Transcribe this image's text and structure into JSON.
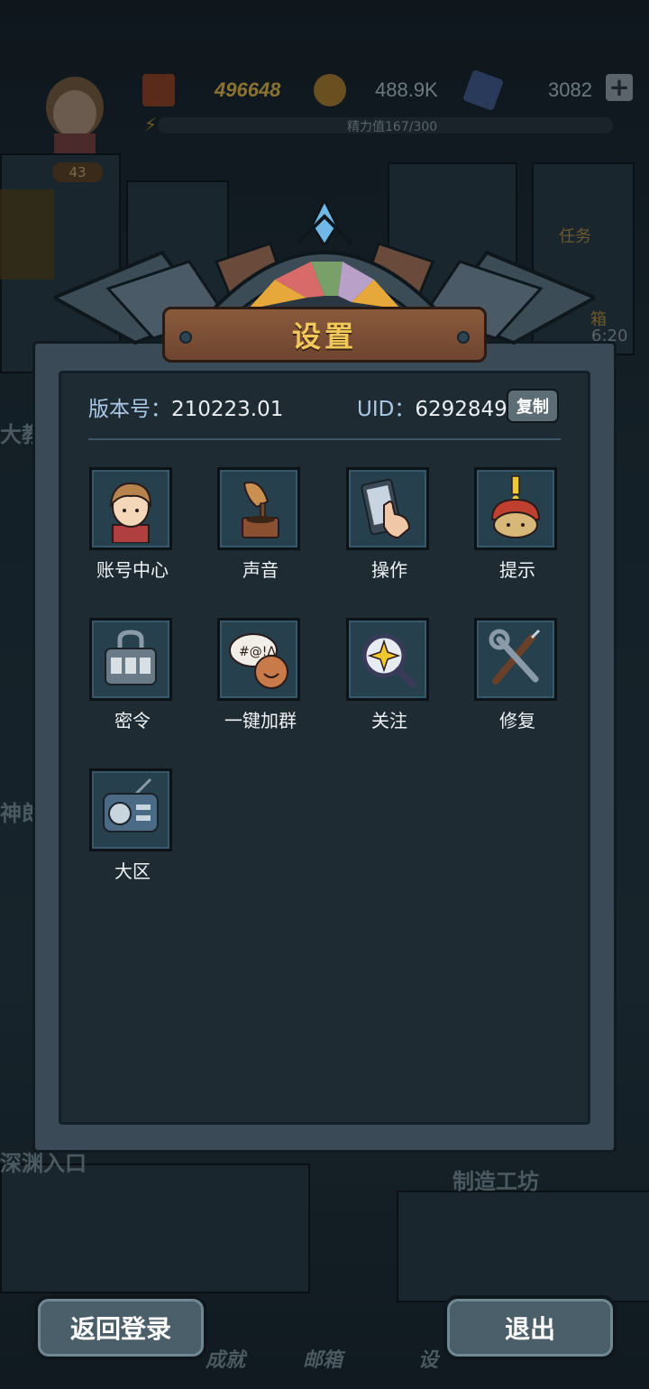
{
  "hud": {
    "gold_value": "496648",
    "coin_value": "488.9K",
    "gem_value": "3082",
    "energy_label": "精力值167/300",
    "level": "43",
    "task_label": "任务",
    "chest_label": "箱",
    "chest_timer": "6:20"
  },
  "scene_labels": {
    "left_1": "大教",
    "left_2": "神郎",
    "abyss": "深渊入口",
    "workshop": "制造工坊",
    "nav_achievement": "成就",
    "nav_mail": "邮箱",
    "nav_settings": "设"
  },
  "panel": {
    "title": "设置",
    "version_label": "版本号：",
    "version_value": "210223.01",
    "uid_label": "UID：",
    "uid_value": "6292849",
    "copy_label": "复制"
  },
  "settings_items": [
    {
      "label": "账号中心",
      "icon": "account-icon"
    },
    {
      "label": "声音",
      "icon": "gramophone-icon"
    },
    {
      "label": "操作",
      "icon": "phone-touch-icon"
    },
    {
      "label": "提示",
      "icon": "alert-helmet-icon"
    },
    {
      "label": "密令",
      "icon": "lock-code-icon"
    },
    {
      "label": "一键加群",
      "icon": "chat-bubble-icon"
    },
    {
      "label": "关注",
      "icon": "magnifier-star-icon"
    },
    {
      "label": "修复",
      "icon": "wrench-screwdriver-icon"
    },
    {
      "label": "大区",
      "icon": "radio-icon"
    }
  ],
  "buttons": {
    "back_login": "返回登录",
    "exit": "退出"
  }
}
